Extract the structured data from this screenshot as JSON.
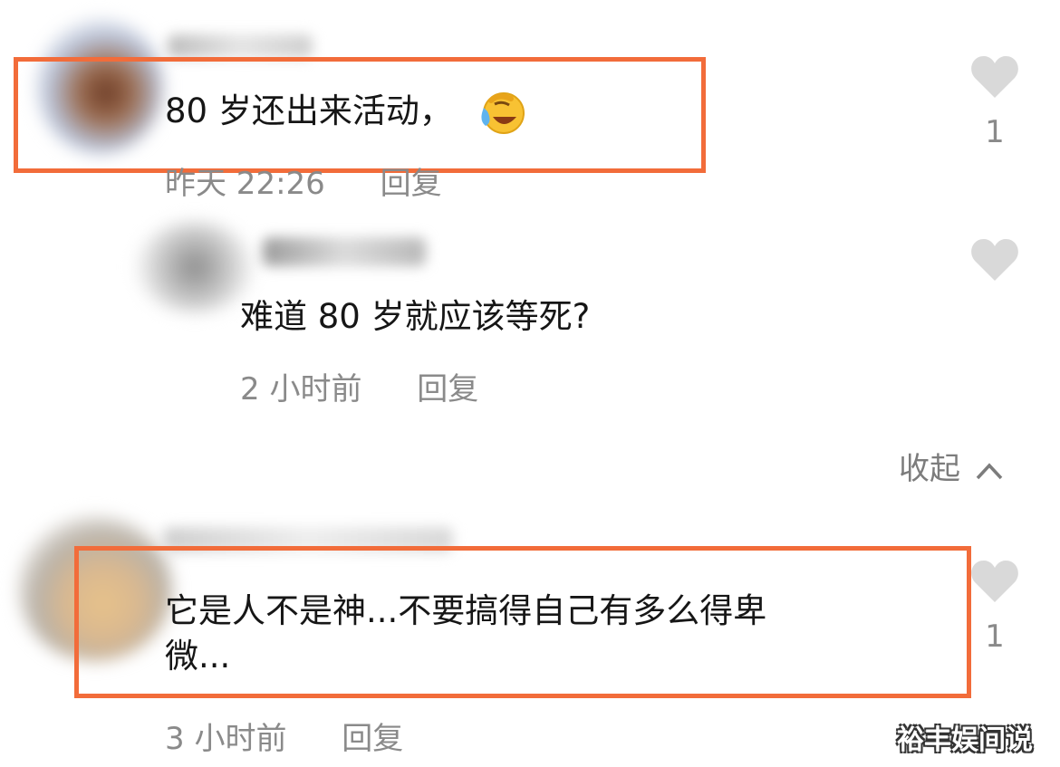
{
  "comments": [
    {
      "text": "80 岁还出来活动，",
      "emoji": "laughing-crying-emoji",
      "time": "昨天 22:26",
      "reply_label": "回复",
      "likes": "1",
      "highlighted": true
    },
    {
      "text": "难道 80 岁就应该等死?",
      "time": "2 小时前",
      "reply_label": "回复",
      "likes": "",
      "is_reply": true
    },
    {
      "text_line1": "它是人不是神...不要搞得自己有多么得卑",
      "text_line2": "微...",
      "time": "3 小时前",
      "reply_label": "回复",
      "likes": "1",
      "highlighted": true
    }
  ],
  "collapse_label": "收起",
  "watermark": "裕丰娱间说",
  "icons": {
    "like": "heart-icon",
    "collapse": "chevron-up-icon"
  },
  "colors": {
    "highlight_border": "#f26c3a",
    "heart": "#d9d9d9",
    "meta_text": "#8a8a8a"
  }
}
